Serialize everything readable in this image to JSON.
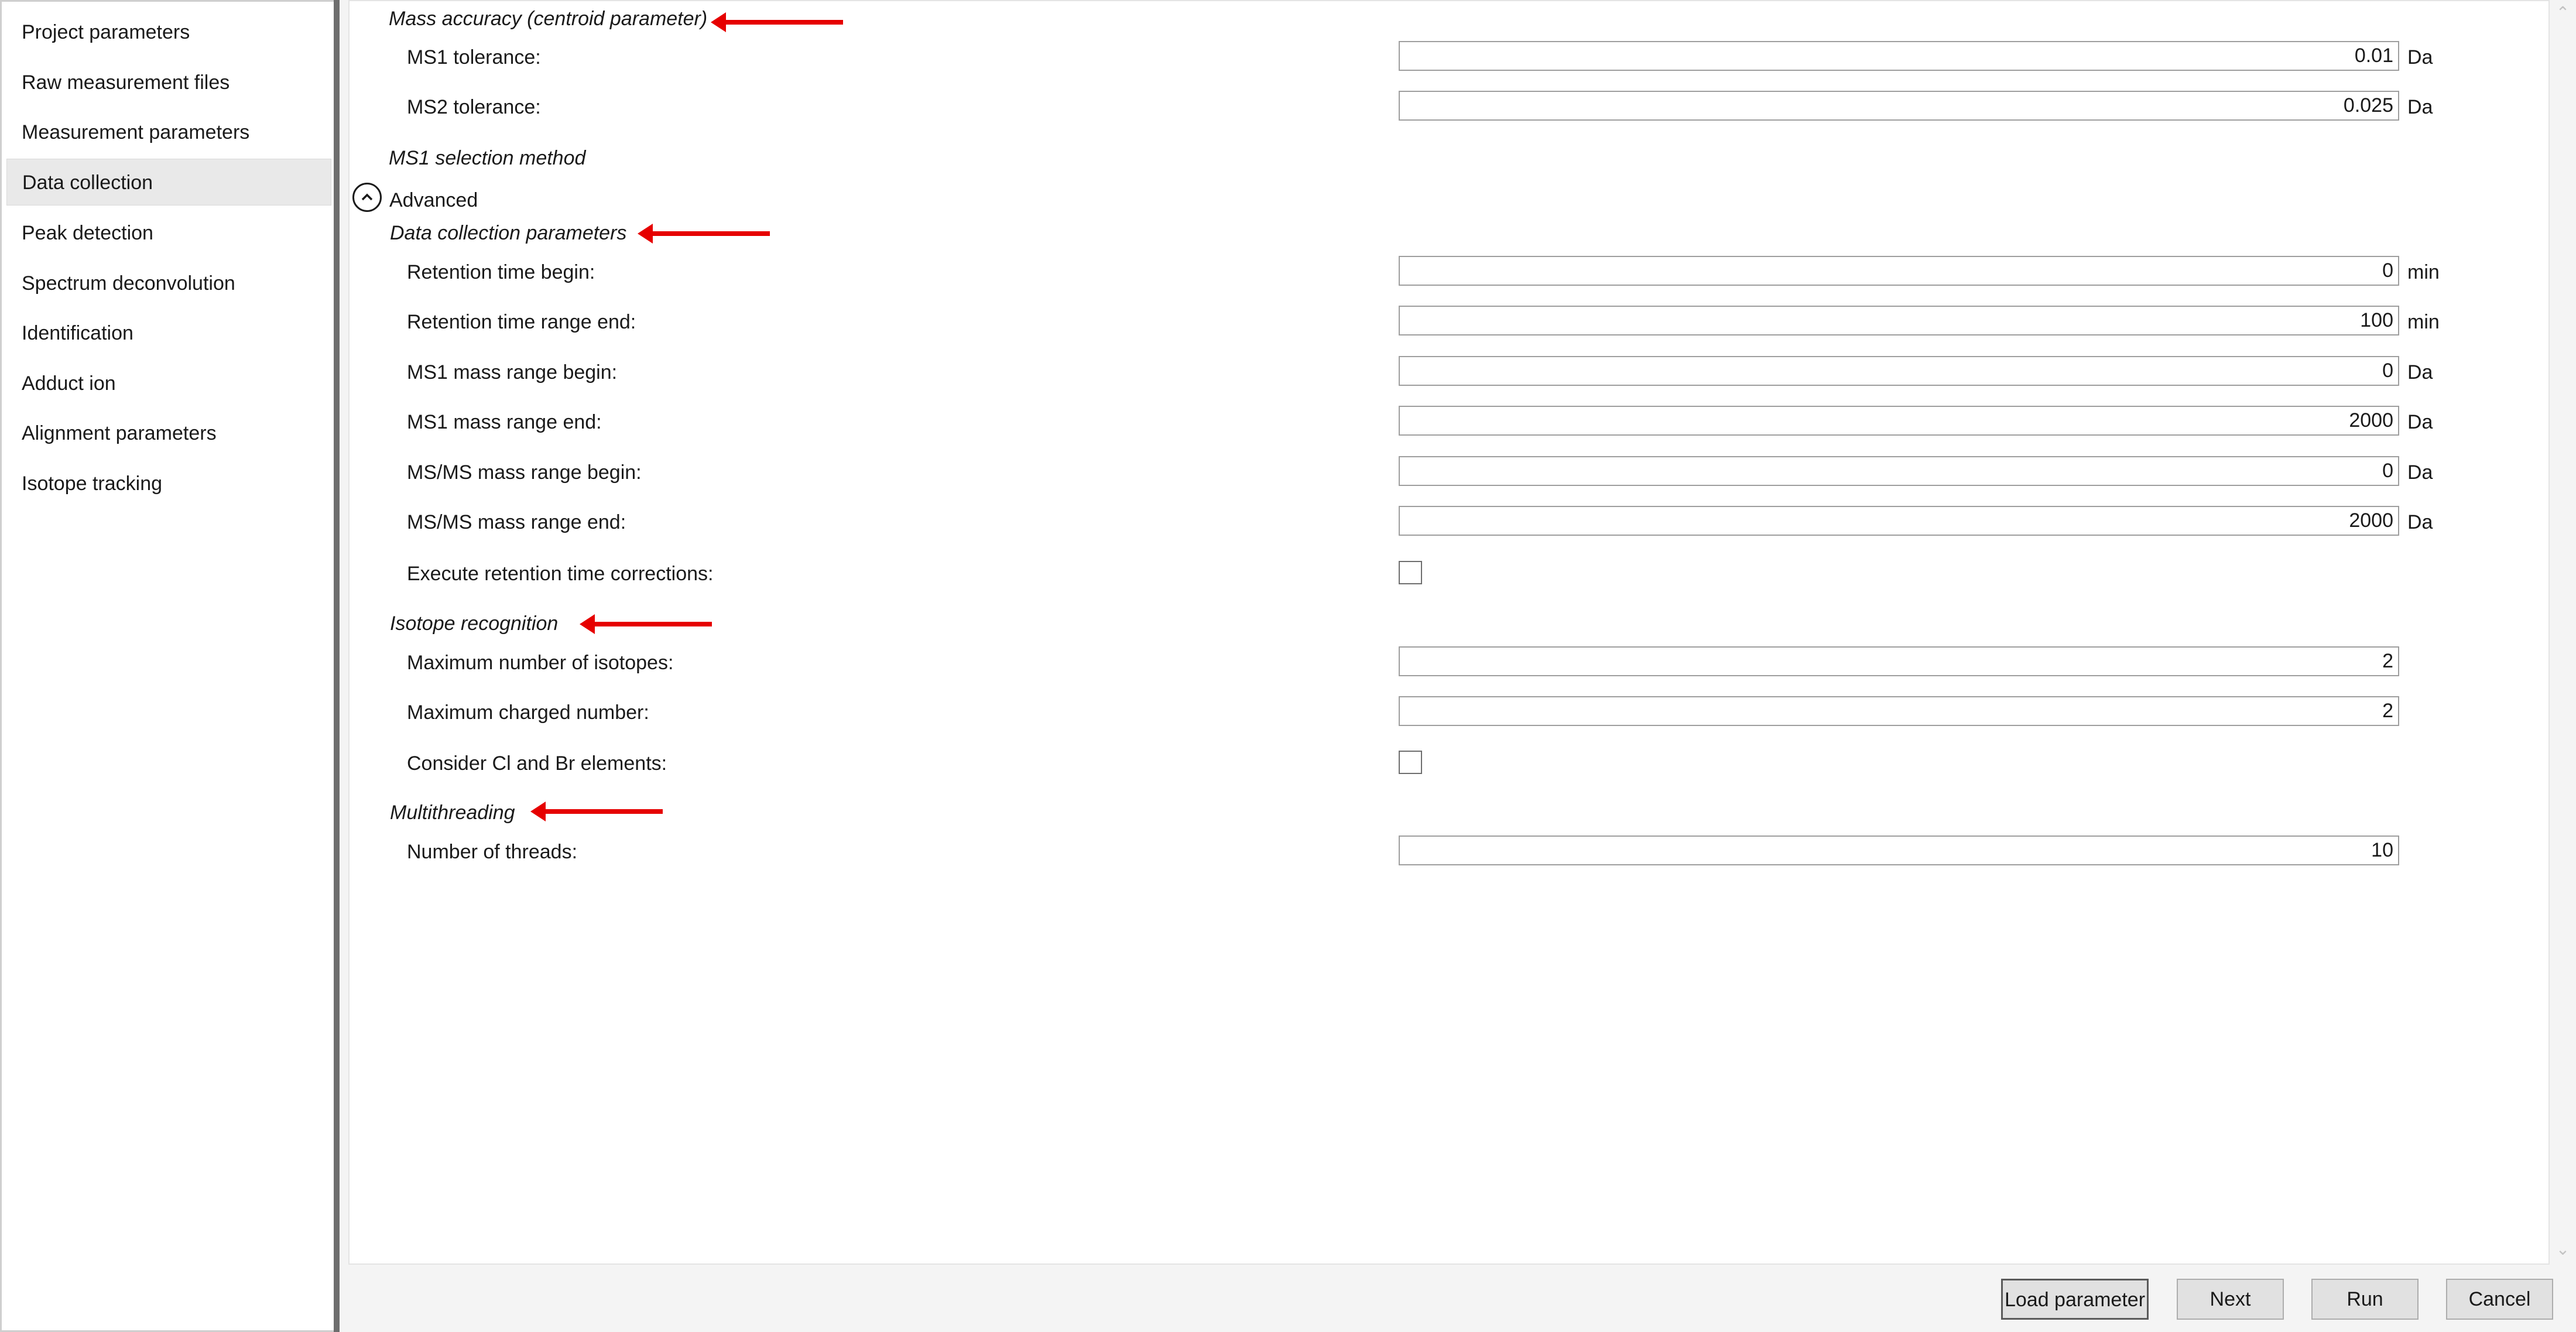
{
  "sidebar": {
    "items": [
      {
        "label": "Project parameters"
      },
      {
        "label": "Raw measurement files"
      },
      {
        "label": "Measurement parameters"
      },
      {
        "label": "Data collection"
      },
      {
        "label": "Peak detection"
      },
      {
        "label": "Spectrum deconvolution"
      },
      {
        "label": "Identification"
      },
      {
        "label": "Adduct ion"
      },
      {
        "label": "Alignment parameters"
      },
      {
        "label": "Isotope tracking"
      }
    ],
    "selected": "Data collection"
  },
  "mass_accuracy": {
    "heading": "Mass accuracy (centroid parameter)",
    "ms1_label": "MS1 tolerance:",
    "ms1_value": "0.01",
    "ms1_unit": "Da",
    "ms2_label": "MS2 tolerance:",
    "ms2_value": "0.025",
    "ms2_unit": "Da"
  },
  "ms1_selection": {
    "heading": "MS1 selection method"
  },
  "advanced": {
    "label": "Advanced",
    "icon": "chevron-up-icon",
    "expanded": true
  },
  "data_collection": {
    "heading": "Data collection parameters",
    "rt_begin_label": "Retention time begin:",
    "rt_begin_value": "0",
    "rt_begin_unit": "min",
    "rt_end_label": "Retention time range end:",
    "rt_end_value": "100",
    "rt_end_unit": "min",
    "ms1_begin_label": "MS1 mass range begin:",
    "ms1_begin_value": "0",
    "ms1_begin_unit": "Da",
    "ms1_end_label": "MS1 mass range end:",
    "ms1_end_value": "2000",
    "ms1_end_unit": "Da",
    "msms_begin_label": "MS/MS mass range begin:",
    "msms_begin_value": "0",
    "msms_begin_unit": "Da",
    "msms_end_label": "MS/MS mass range end:",
    "msms_end_value": "2000",
    "msms_end_unit": "Da",
    "rt_correction_label": "Execute retention time corrections:",
    "rt_correction_checked": false
  },
  "isotope": {
    "heading": "Isotope recognition",
    "max_isotopes_label": "Maximum number of isotopes:",
    "max_isotopes_value": "2",
    "max_charge_label": "Maximum charged number:",
    "max_charge_value": "2",
    "cl_br_label": "Consider Cl and Br elements:",
    "cl_br_checked": false
  },
  "multithreading": {
    "heading": "Multithreading",
    "threads_label": "Number of threads:",
    "threads_value": "10"
  },
  "annotation_color": "#e60000",
  "buttons": {
    "load": "Load parameter",
    "next": "Next",
    "run": "Run",
    "cancel": "Cancel"
  }
}
